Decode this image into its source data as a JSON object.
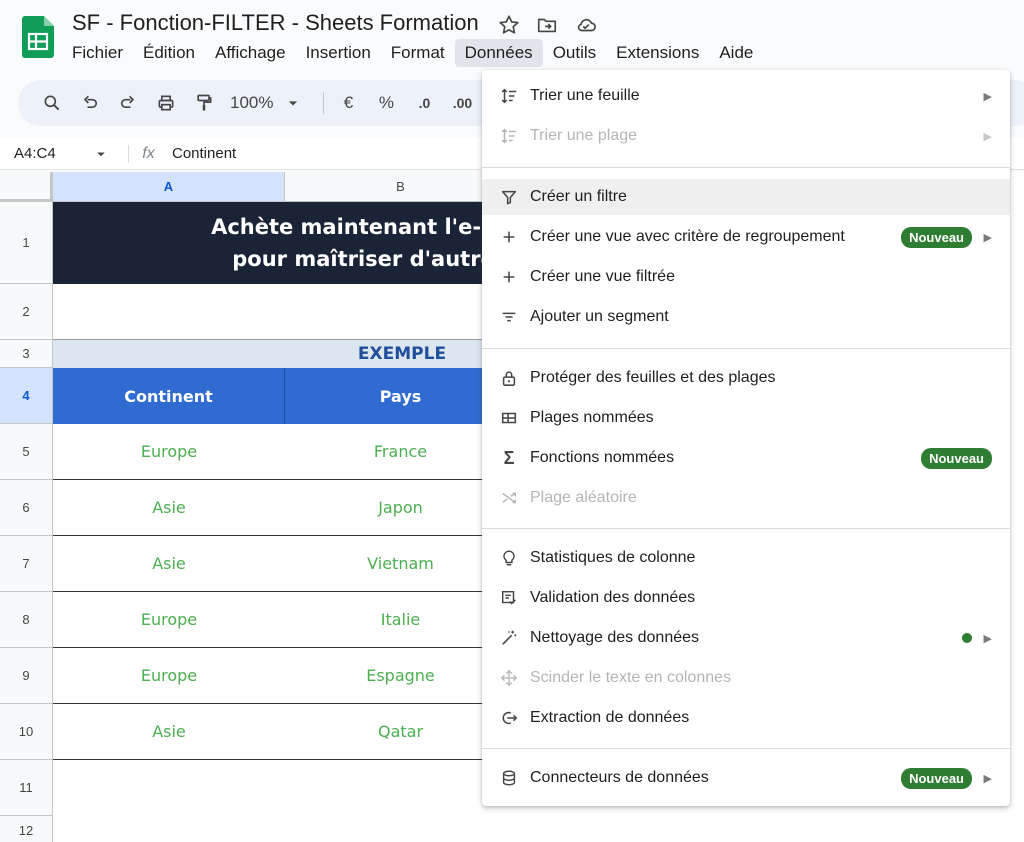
{
  "document": {
    "title": "SF - Fonction-FILTER - Sheets Formation"
  },
  "colors": {
    "brand_green": "#0f9d58",
    "header_blue": "#2f6bd1",
    "banner_navy": "#1b2437",
    "data_green": "#4caf50",
    "badge_green": "#2e7d32"
  },
  "icons": {
    "logo": "sheets-logo-icon",
    "title": [
      "star-icon",
      "move-folder-icon",
      "cloud-status-icon"
    ]
  },
  "menubar": [
    "Fichier",
    "Édition",
    "Affichage",
    "Insertion",
    "Format",
    "Données",
    "Outils",
    "Extensions",
    "Aide"
  ],
  "menubar_active": "Données",
  "toolbar": {
    "zoom": "100%",
    "currency": "€",
    "percent": "%",
    "decrease_decimals": ".0",
    "increase_decimals": ".00"
  },
  "formula_bar": {
    "name_box": "A4:C4",
    "fx": "fx",
    "content": "Continent"
  },
  "grid": {
    "columns": [
      "A",
      "B"
    ],
    "rows": [
      "1",
      "2",
      "3",
      "4",
      "5",
      "6",
      "7",
      "8",
      "9",
      "10",
      "11",
      "12"
    ],
    "banner_line1": "Achète maintenant l'e-boo",
    "banner_line2": "pour maîtriser d'autres f",
    "example_label": "EXEMPLE",
    "headers": [
      "Continent",
      "Pays"
    ],
    "data_rows": [
      [
        "Europe",
        "France"
      ],
      [
        "Asie",
        "Japon"
      ],
      [
        "Asie",
        "Vietnam"
      ],
      [
        "Europe",
        "Italie"
      ],
      [
        "Europe",
        "Espagne"
      ],
      [
        "Asie",
        "Qatar"
      ]
    ]
  },
  "dropdown": {
    "new_badge": "Nouveau",
    "items": [
      {
        "label": "Trier une feuille",
        "icon": "sort-icon",
        "submenu": true,
        "disabled": false
      },
      {
        "label": "Trier une plage",
        "icon": "sort-icon",
        "submenu": true,
        "disabled": true
      },
      {
        "label": "Créer un filtre",
        "icon": "filter-icon",
        "submenu": false,
        "disabled": false
      },
      {
        "label": "Créer une vue avec critère de regroupement",
        "icon": "plus-icon",
        "submenu": true,
        "disabled": false
      },
      {
        "label": "Créer une vue filtrée",
        "icon": "plus-icon",
        "submenu": false,
        "disabled": false
      },
      {
        "label": "Ajouter un segment",
        "icon": "slicer-icon",
        "submenu": false,
        "disabled": false
      },
      {
        "label": "Protéger des feuilles et des plages",
        "icon": "lock-icon",
        "submenu": false,
        "disabled": false
      },
      {
        "label": "Plages nommées",
        "icon": "named-range-icon",
        "submenu": false,
        "disabled": false
      },
      {
        "label": "Fonctions nommées",
        "icon": "sigma-icon",
        "submenu": false,
        "disabled": false
      },
      {
        "label": "Plage aléatoire",
        "icon": "shuffle-icon",
        "submenu": false,
        "disabled": true
      },
      {
        "label": "Statistiques de colonne",
        "icon": "lightbulb-icon",
        "submenu": false,
        "disabled": false
      },
      {
        "label": "Validation des données",
        "icon": "validation-icon",
        "submenu": false,
        "disabled": false
      },
      {
        "label": "Nettoyage des données",
        "icon": "magic-wand-icon",
        "submenu": true,
        "disabled": false
      },
      {
        "label": "Scinder le texte en colonnes",
        "icon": "split-icon",
        "submenu": false,
        "disabled": true
      },
      {
        "label": "Extraction de données",
        "icon": "extract-icon",
        "submenu": false,
        "disabled": false
      },
      {
        "label": "Connecteurs de données",
        "icon": "database-icon",
        "submenu": true,
        "disabled": false
      }
    ]
  }
}
